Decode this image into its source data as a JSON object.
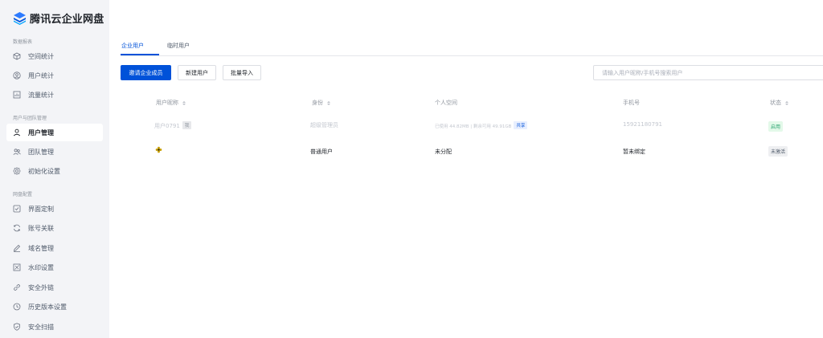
{
  "app": {
    "logo_text": "腾讯云企业网盘"
  },
  "sidebar": {
    "groups": [
      {
        "title": "数据报表",
        "items": [
          {
            "label": "空间统计",
            "icon": "cube-icon"
          },
          {
            "label": "用户统计",
            "icon": "user-circle-icon"
          },
          {
            "label": "流量统计",
            "icon": "chart-icon"
          }
        ]
      },
      {
        "title": "用户与团队管理",
        "items": [
          {
            "label": "用户管理",
            "icon": "user-icon",
            "active": true
          },
          {
            "label": "团队管理",
            "icon": "team-icon"
          },
          {
            "label": "初始化设置",
            "icon": "gear-icon"
          }
        ]
      },
      {
        "title": "网盘配置",
        "items": [
          {
            "label": "界面定制",
            "icon": "checkbox-icon"
          },
          {
            "label": "账号关联",
            "icon": "sync-icon"
          },
          {
            "label": "域名管理",
            "icon": "pen-icon"
          },
          {
            "label": "水印设置",
            "icon": "watermark-icon"
          },
          {
            "label": "安全外链",
            "icon": "link-icon"
          },
          {
            "label": "历史版本设置",
            "icon": "clock-icon"
          },
          {
            "label": "安全扫描",
            "icon": "shield-icon"
          }
        ]
      }
    ]
  },
  "tabs": [
    {
      "label": "企业用户",
      "active": true
    },
    {
      "label": "临时用户"
    }
  ],
  "toolbar": {
    "invite_label": "邀请企业成员",
    "new_user_label": "新建用户",
    "import_label": "批量导入"
  },
  "search": {
    "placeholder": "请输入用户昵称/手机号搜索用户"
  },
  "table": {
    "headers": {
      "nickname": "用户昵称",
      "role": "身份",
      "space": "个人空间",
      "phone": "手机号",
      "status": "状态"
    },
    "rows": [
      {
        "nickname": "用户0791",
        "me_tag": "我",
        "role": "超级管理员",
        "space_text": "已使用 44.82MB | 剩余可用 49.91GB",
        "share_tag": "共享",
        "phone": "15921180791",
        "status": "启用"
      },
      {
        "nickname": "",
        "avatar_icon": "flower-icon",
        "role": "普通用户",
        "space_text": "未分配",
        "phone": "暂未绑定",
        "status": "未激活"
      }
    ]
  },
  "colors": {
    "primary": "#0052d9",
    "sidebar_bg": "#f3f4f7",
    "status_enabled": "#2ba471"
  }
}
